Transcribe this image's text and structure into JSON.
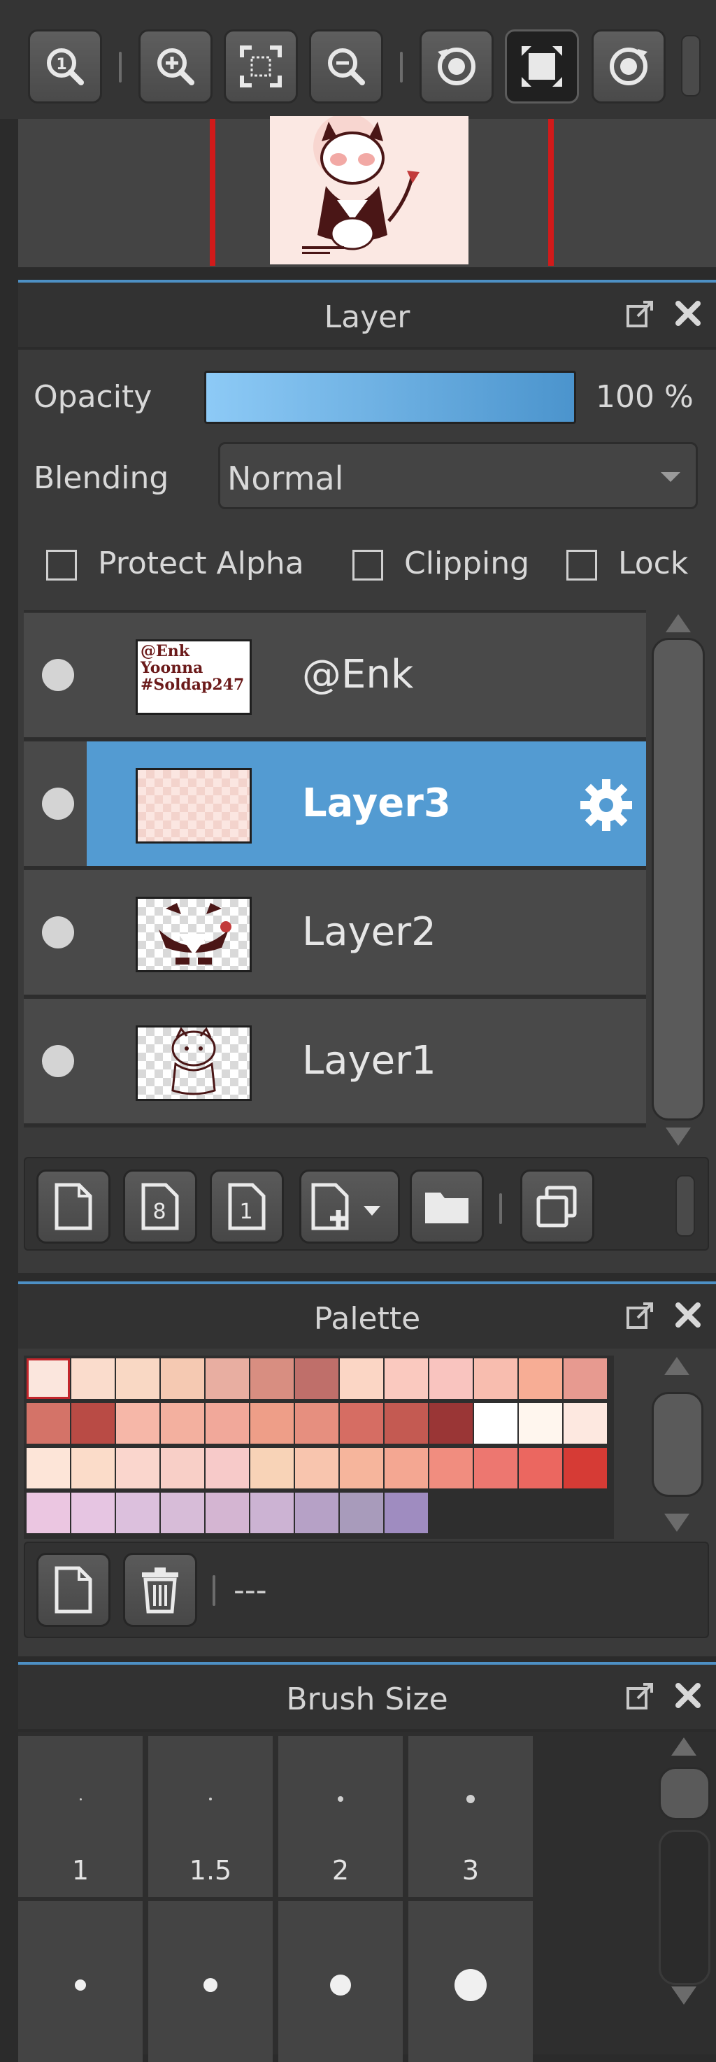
{
  "navigator": {
    "tools": [
      {
        "icon": "zoom-actual-icon"
      },
      {
        "icon": "zoom-in-icon"
      },
      {
        "icon": "fit-screen-icon"
      },
      {
        "icon": "zoom-out-icon"
      },
      {
        "icon": "rotate-left-icon"
      },
      {
        "icon": "fullscreen-icon",
        "active": true
      },
      {
        "icon": "rotate-right-icon"
      }
    ]
  },
  "layer_panel": {
    "title": "Layer",
    "opacity_label": "Opacity",
    "opacity_value": "100 %",
    "opacity_fraction": 1.0,
    "blending_label": "Blending",
    "blending_value": "Normal",
    "checkboxes": {
      "protect_alpha": "Protect Alpha",
      "clipping": "Clipping",
      "lock": "Lock"
    },
    "layers": [
      {
        "name": "@Enk",
        "selected": false,
        "thumb_text": [
          "@Enk",
          "Yoonna",
          "#Soldap247"
        ]
      },
      {
        "name": "Layer3",
        "selected": true
      },
      {
        "name": "Layer2",
        "selected": false
      },
      {
        "name": "Layer1",
        "selected": false
      }
    ],
    "tools": [
      "new-layer-icon",
      "new-8bit-layer-icon",
      "new-1bit-layer-icon",
      "add-layer-menu-icon",
      "new-folder-icon",
      "duplicate-layer-icon"
    ]
  },
  "palette_panel": {
    "title": "Palette",
    "swatches": [
      [
        "#fbe6dd",
        "#fadccc",
        "#f9d8c4",
        "#f5c9b2",
        "#e8aea1",
        "#d88e81",
        "#bf6f6a",
        "#fbd6c5",
        "#fac9bf",
        "#f9c4bf",
        "#f8bdaf",
        "#f7ad95",
        "#e79a90"
      ],
      [
        "#d47368",
        "#b94b45",
        "#f6b7a8",
        "#f3b09f",
        "#f1a89a",
        "#ee9e88",
        "#e68f7f",
        "#d66d63",
        "#c45a52",
        "#9a3636",
        "#ffffff",
        "#fff6ee",
        "#fde8e0"
      ],
      [
        "#fde5d8",
        "#fbdcc9",
        "#fad6cd",
        "#f8cfc7",
        "#f7cac9",
        "#f8d3b7",
        "#f8c5ae",
        "#f6b59c",
        "#f4a792",
        "#f18d7f",
        "#ed7770",
        "#eb6760",
        "#d63b35"
      ],
      [
        "#ebc6e1",
        "#e6c5e2",
        "#dcc0dd",
        "#d7bcd8",
        "#d4b5d2",
        "#ccb3d3",
        "#b6a1c6",
        "#a89bbb",
        "#9f8cc0"
      ]
    ],
    "palette_name": "---",
    "tools": [
      "new-palette-icon",
      "delete-palette-icon"
    ]
  },
  "brush_panel": {
    "title": "Brush Size",
    "sizes": [
      {
        "label": "1",
        "dot": 3
      },
      {
        "label": "1.5",
        "dot": 4
      },
      {
        "label": "2",
        "dot": 8
      },
      {
        "label": "3",
        "dot": 12
      },
      {
        "label": "",
        "dot": 16
      },
      {
        "label": "",
        "dot": 20
      },
      {
        "label": "",
        "dot": 30
      },
      {
        "label": "",
        "dot": 46
      }
    ]
  }
}
